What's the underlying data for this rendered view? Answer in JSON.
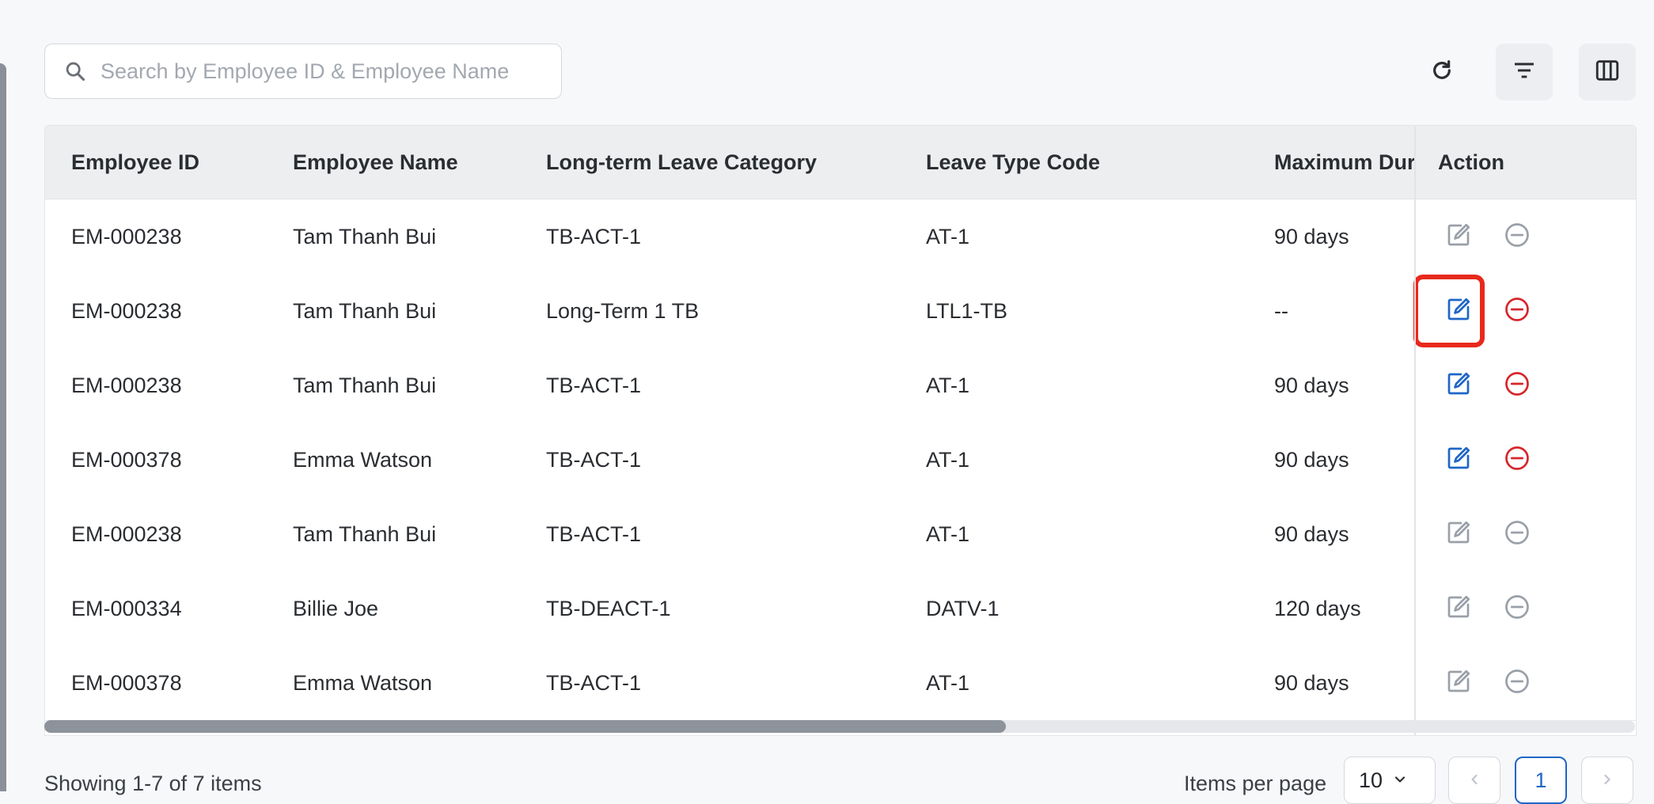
{
  "search": {
    "placeholder": "Search by Employee ID & Employee Name",
    "icon": "search-icon"
  },
  "toolbar": {
    "refresh_icon": "refresh-icon",
    "filter_icon": "filter-icon",
    "columns_icon": "columns-icon"
  },
  "table": {
    "headers": [
      "Employee ID",
      "Employee Name",
      "Long-term Leave Category",
      "Leave Type Code",
      "Maximum Dur",
      "Action"
    ],
    "rows": [
      {
        "employee_id": "EM-000238",
        "employee_name": "Tam Thanh Bui",
        "category": "TB-ACT-1",
        "leave_code": "AT-1",
        "max_duration": "90 days",
        "actions_enabled": false
      },
      {
        "employee_id": "EM-000238",
        "employee_name": "Tam Thanh Bui",
        "category": "Long-Term 1 TB",
        "leave_code": "LTL1-TB",
        "max_duration": "--",
        "actions_enabled": true,
        "highlighted": true
      },
      {
        "employee_id": "EM-000238",
        "employee_name": "Tam Thanh Bui",
        "category": "TB-ACT-1",
        "leave_code": "AT-1",
        "max_duration": "90 days",
        "actions_enabled": true
      },
      {
        "employee_id": "EM-000378",
        "employee_name": "Emma Watson",
        "category": "TB-ACT-1",
        "leave_code": "AT-1",
        "max_duration": "90 days",
        "actions_enabled": true
      },
      {
        "employee_id": "EM-000238",
        "employee_name": "Tam Thanh Bui",
        "category": "TB-ACT-1",
        "leave_code": "AT-1",
        "max_duration": "90 days",
        "actions_enabled": false
      },
      {
        "employee_id": "EM-000334",
        "employee_name": "Billie Joe",
        "category": "TB-DEACT-1",
        "leave_code": "DATV-1",
        "max_duration": "120 days",
        "actions_enabled": false
      },
      {
        "employee_id": "EM-000378",
        "employee_name": "Emma Watson",
        "category": "TB-ACT-1",
        "leave_code": "AT-1",
        "max_duration": "90 days",
        "actions_enabled": false
      }
    ]
  },
  "footer": {
    "showing": "Showing 1-7 of 7 items",
    "items_per_page_label": "Items per page",
    "items_per_page_value": "10",
    "current_page": "1"
  },
  "colors": {
    "accent": "#1f66c7",
    "danger": "#d7262b",
    "disabled": "#9aa0a8",
    "highlight": "#e8291c"
  }
}
